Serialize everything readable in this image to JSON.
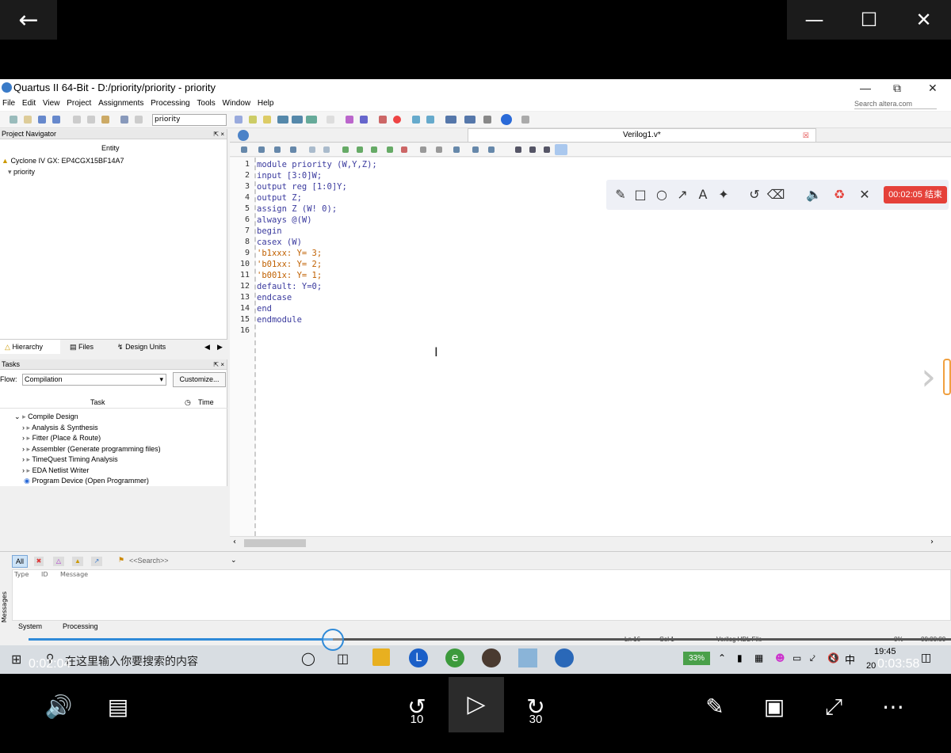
{
  "player": {
    "time_current": "0:02:04",
    "time_total": "0:03:58",
    "progress_fraction": 0.33,
    "skip_back_label": "10",
    "skip_forward_label": "30"
  },
  "quartus": {
    "title": "Quartus II 64-Bit - D:/priority/priority - priority",
    "menu": [
      "File",
      "Edit",
      "View",
      "Project",
      "Assignments",
      "Processing",
      "Tools",
      "Window",
      "Help"
    ],
    "search_placeholder": "Search altera.com",
    "toolbar_combo": "priority",
    "project_navigator": {
      "header": "Project Navigator",
      "entity_header": "Entity",
      "device": "Cyclone IV GX: EP4CGX15BF14A7",
      "top_entity": "priority"
    },
    "nav_tabs": [
      "Hierarchy",
      "Files",
      "Design Units"
    ],
    "tasks": {
      "header": "Tasks",
      "flow_label": "Flow:",
      "flow_value": "Compilation",
      "customize_label": "Customize...",
      "col_task": "Task",
      "col_time": "Time",
      "rows": [
        "Compile Design",
        "Analysis & Synthesis",
        "Fitter (Place & Route)",
        "Assembler (Generate programming files)",
        "TimeQuest Timing Analysis",
        "EDA Netlist Writer",
        "Program Device (Open Programmer)"
      ]
    },
    "editor": {
      "tab_label": "Verilog1.v*",
      "close_icon": "close-icon",
      "lines": [
        {
          "n": "1",
          "code": "module priority (W,Y,Z);"
        },
        {
          "n": "2",
          "code": "input [3:0]W;"
        },
        {
          "n": "3",
          "code": "output reg [1:0]Y;"
        },
        {
          "n": "4",
          "code": "output Z;"
        },
        {
          "n": "5",
          "code": "assign Z (W! 0);"
        },
        {
          "n": "6",
          "code": "always @(W)"
        },
        {
          "n": "7",
          "code": "begin"
        },
        {
          "n": "8",
          "code": "casex (W)"
        },
        {
          "n": "9",
          "code": "'b1xxx: Y= 3;"
        },
        {
          "n": "10",
          "code": "'b01xx: Y= 2;"
        },
        {
          "n": "11",
          "code": "'b001x: Y= 1;"
        },
        {
          "n": "12",
          "code": "default: Y=0;"
        },
        {
          "n": "13",
          "code": "endcase"
        },
        {
          "n": "14",
          "code": "end"
        },
        {
          "n": "15",
          "code": "endmodule"
        },
        {
          "n": "16",
          "code": ""
        }
      ]
    },
    "messages": {
      "filter_all": "All",
      "search_placeholder": "<<Search>>",
      "cols": [
        "Type",
        "ID",
        "Message"
      ],
      "side_label": "Messages",
      "tabs": [
        "System",
        "Processing"
      ]
    },
    "status": {
      "ln": "Ln 16",
      "col": "Col 1",
      "file_type": "Verilog HDL File",
      "percent": "0%",
      "elapsed": "00:00:00"
    }
  },
  "taskbar": {
    "search_placeholder": "在这里输入你要搜索的内容",
    "battery": "33%",
    "ime": "中",
    "clock_time": "19:45",
    "clock_date": "20"
  },
  "annotation_toolbar": {
    "timer_label": "00:02:05 结束"
  },
  "colors": {
    "accent": "#2f8ad8",
    "record": "#e5413a",
    "keyword": "#3a3a9e",
    "number": "#c06000"
  }
}
